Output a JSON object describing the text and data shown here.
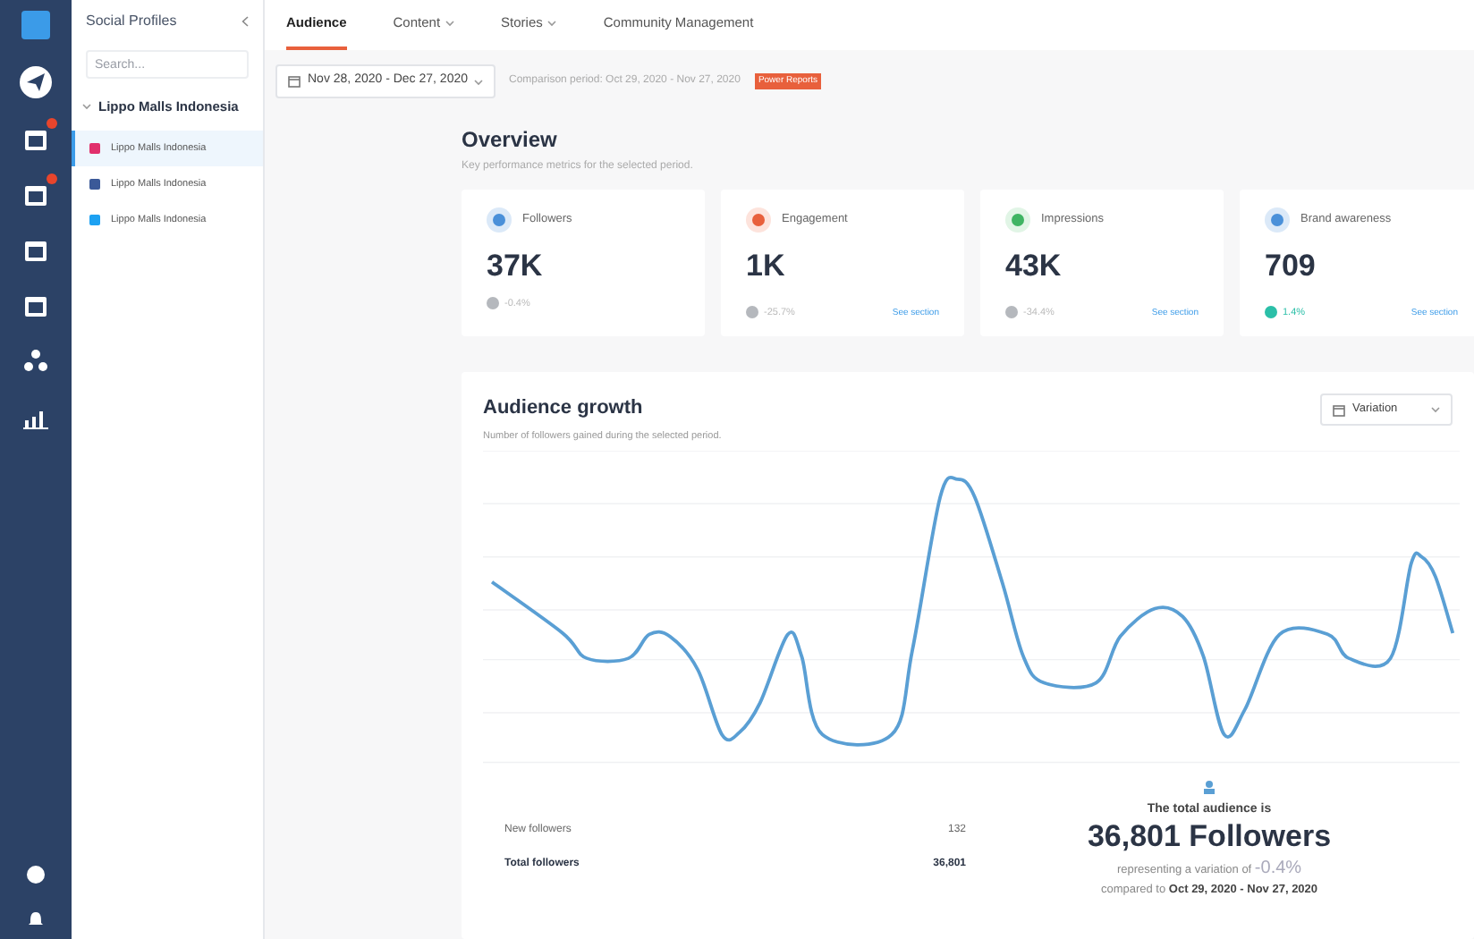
{
  "sidebar": {
    "title": "Social Profiles",
    "search": {
      "placeholder": "Search..."
    },
    "group": {
      "label": "Lippo Malls Indonesia",
      "expanded": true,
      "children": [
        {
          "label": "Lippo Malls Indonesia",
          "selected": true,
          "color": "#e1306c"
        },
        {
          "label": "Lippo Malls Indonesia",
          "selected": false,
          "color": "#3b5998"
        },
        {
          "label": "Lippo Malls Indonesia",
          "selected": false,
          "color": "#1da1f2"
        }
      ]
    }
  },
  "tabs": [
    {
      "label": "Audience",
      "selected": true,
      "dropdown": false
    },
    {
      "label": "Content",
      "selected": false,
      "dropdown": true
    },
    {
      "label": "Stories",
      "selected": false,
      "dropdown": true
    },
    {
      "label": "Community Management",
      "selected": false,
      "dropdown": false
    }
  ],
  "date_range": "Nov 28, 2020 - Dec 27, 2020",
  "comparison": "Comparison period: Oct 29, 2020 - Nov 27, 2020",
  "badge": "Power Reports",
  "overview": {
    "title": "Overview",
    "subtitle": "Key performance metrics for the selected period.",
    "cards": [
      {
        "kind": "followers",
        "label": "Followers",
        "value": "37K",
        "change": "-0.4%",
        "positive": false
      },
      {
        "kind": "engagement",
        "label": "Engagement",
        "value": "1K",
        "change": "-25.7%",
        "positive": false,
        "link": "See section"
      },
      {
        "kind": "impressions",
        "label": "Impressions",
        "value": "43K",
        "change": "-34.4%",
        "positive": false,
        "link": "See section"
      },
      {
        "kind": "awareness",
        "label": "Brand awareness",
        "value": "709",
        "change": "1.4%",
        "positive": true,
        "link": "See section"
      }
    ]
  },
  "growth": {
    "title": "Audience growth",
    "subtitle": "Number of followers gained during the selected period.",
    "selector": "Variation",
    "stats": [
      {
        "label": "New followers",
        "value": "132",
        "bold": false
      },
      {
        "label": "Total followers",
        "value": "36,801",
        "bold": true
      }
    ],
    "summary": {
      "intro": "The total audience is",
      "total": "36,801 Followers",
      "variation_text": "representing a variation of",
      "variation": "-0.4%",
      "compared_text": "compared to",
      "compared_period": "Oct 29, 2020 - Nov 27, 2020"
    }
  }
}
